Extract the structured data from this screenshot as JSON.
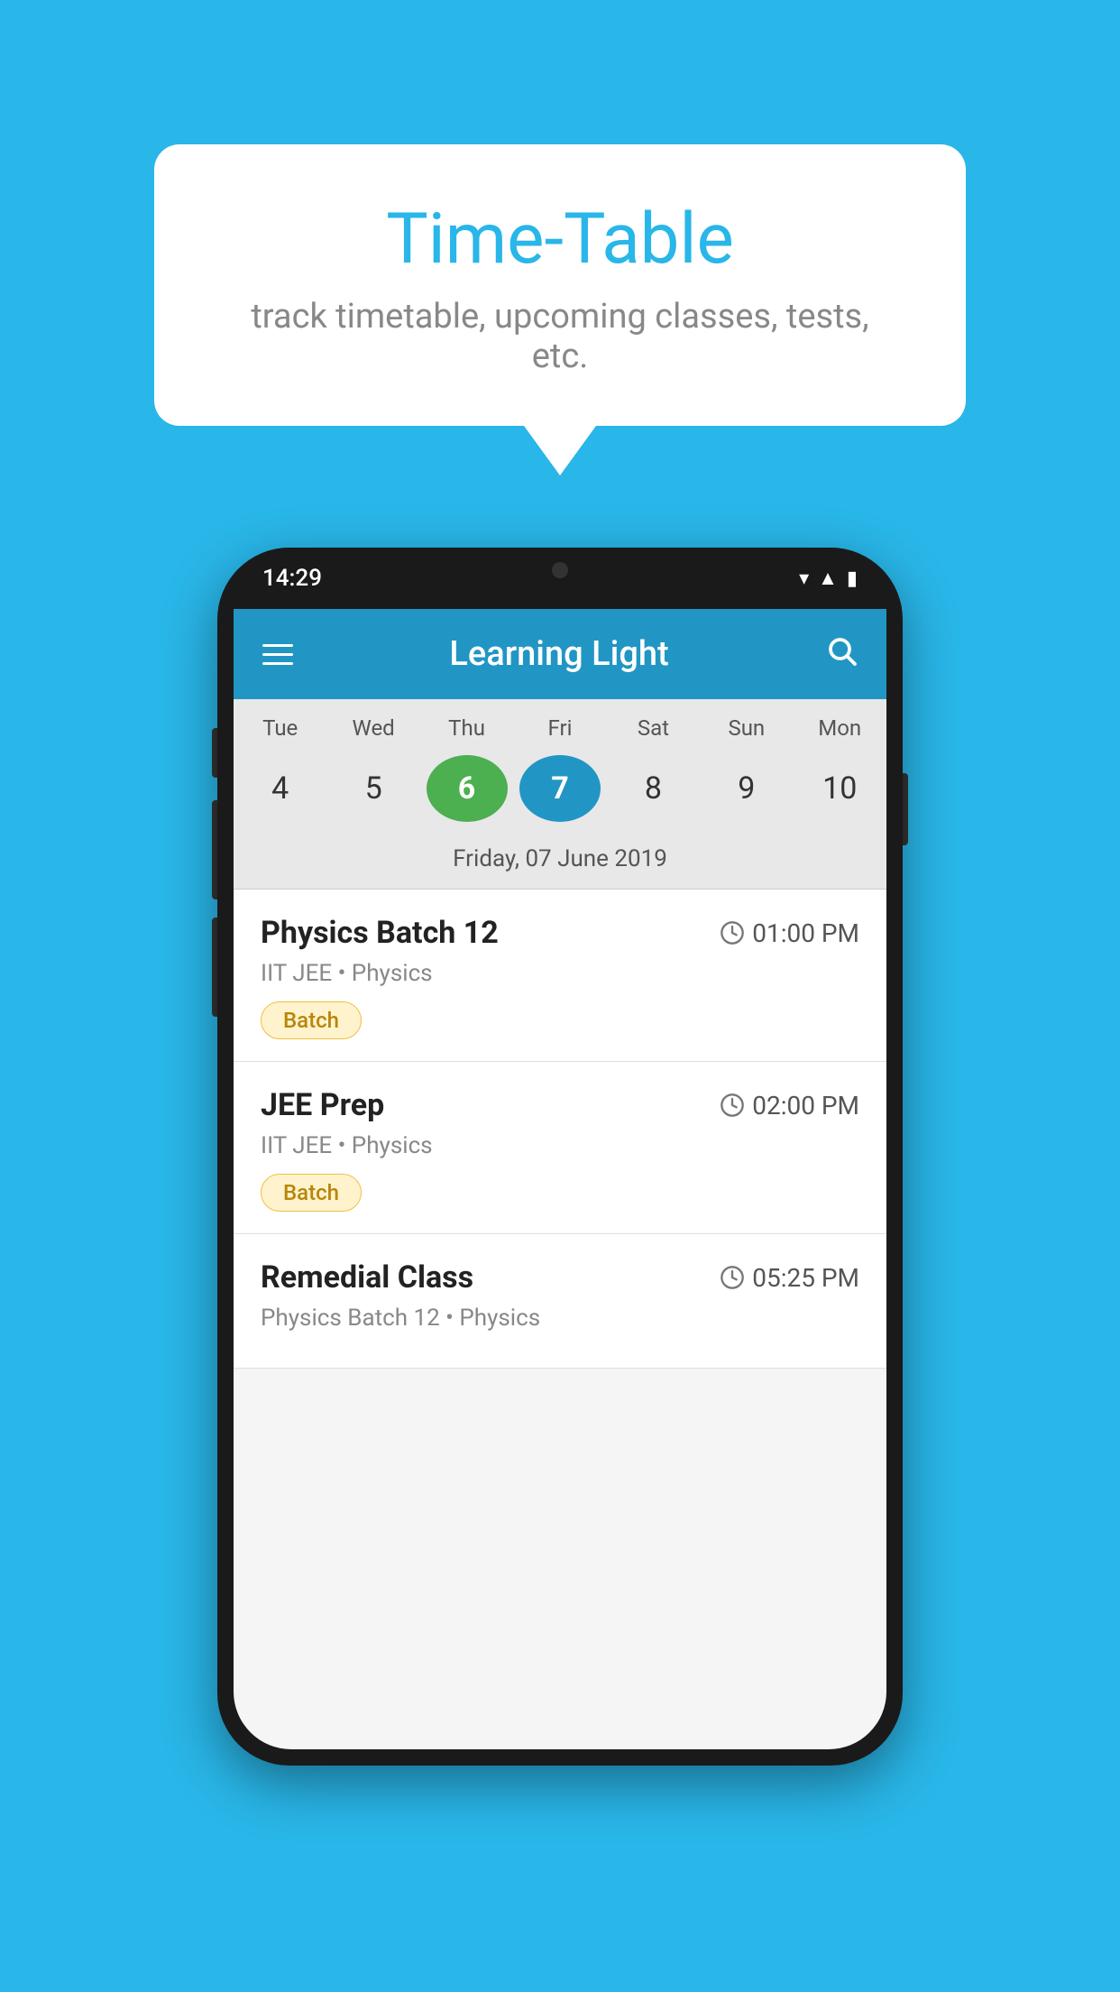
{
  "background_color": "#29B6E8",
  "speech_bubble": {
    "title": "Time-Table",
    "subtitle": "track timetable, upcoming classes, tests, etc."
  },
  "phone": {
    "status_bar": {
      "time": "14:29"
    },
    "app_bar": {
      "title": "Learning Light"
    },
    "calendar": {
      "days": [
        "Tue",
        "Wed",
        "Thu",
        "Fri",
        "Sat",
        "Sun",
        "Mon"
      ],
      "dates": [
        "4",
        "5",
        "6",
        "7",
        "8",
        "9",
        "10"
      ],
      "today_index": 2,
      "selected_index": 3,
      "selected_label": "Friday, 07 June 2019"
    },
    "schedule": [
      {
        "title": "Physics Batch 12",
        "time": "01:00 PM",
        "subtitle": "IIT JEE • Physics",
        "tag": "Batch"
      },
      {
        "title": "JEE Prep",
        "time": "02:00 PM",
        "subtitle": "IIT JEE • Physics",
        "tag": "Batch"
      },
      {
        "title": "Remedial Class",
        "time": "05:25 PM",
        "subtitle": "Physics Batch 12 • Physics",
        "tag": null
      }
    ]
  }
}
